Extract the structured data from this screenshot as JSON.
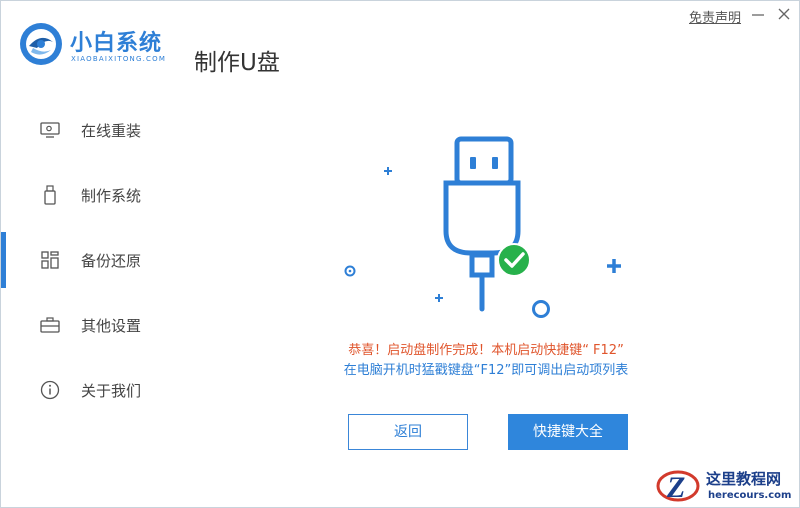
{
  "app": {
    "brand": "小白系统",
    "brand_sub": "XIAOBAIXITONG.COM",
    "page_title": "制作U盘"
  },
  "window": {
    "disclaimer": "免责声明",
    "minimize_icon": "minimize-icon",
    "close_icon": "close-icon"
  },
  "sidebar": {
    "items": [
      {
        "label": "在线重装",
        "icon": "monitor-icon"
      },
      {
        "label": "制作系统",
        "icon": "usb-drive-icon"
      },
      {
        "label": "备份还原",
        "icon": "grid-icon",
        "active": true
      },
      {
        "label": "其他设置",
        "icon": "briefcase-icon"
      },
      {
        "label": "关于我们",
        "icon": "info-icon"
      }
    ]
  },
  "main": {
    "message_line1": "恭喜！启动盘制作完成！本机启动快捷键“ F12”",
    "message_line2": "在电脑开机时猛戳键盘“F12”即可调出启动项列表",
    "back_button": "返回",
    "shortcut_button": "快捷键大全"
  },
  "watermark": {
    "title": "这里教程网",
    "url": "herecours.com"
  },
  "colors": {
    "accent": "#2e7fd6",
    "success": "#27b14b",
    "warning_text": "#e0552c"
  }
}
